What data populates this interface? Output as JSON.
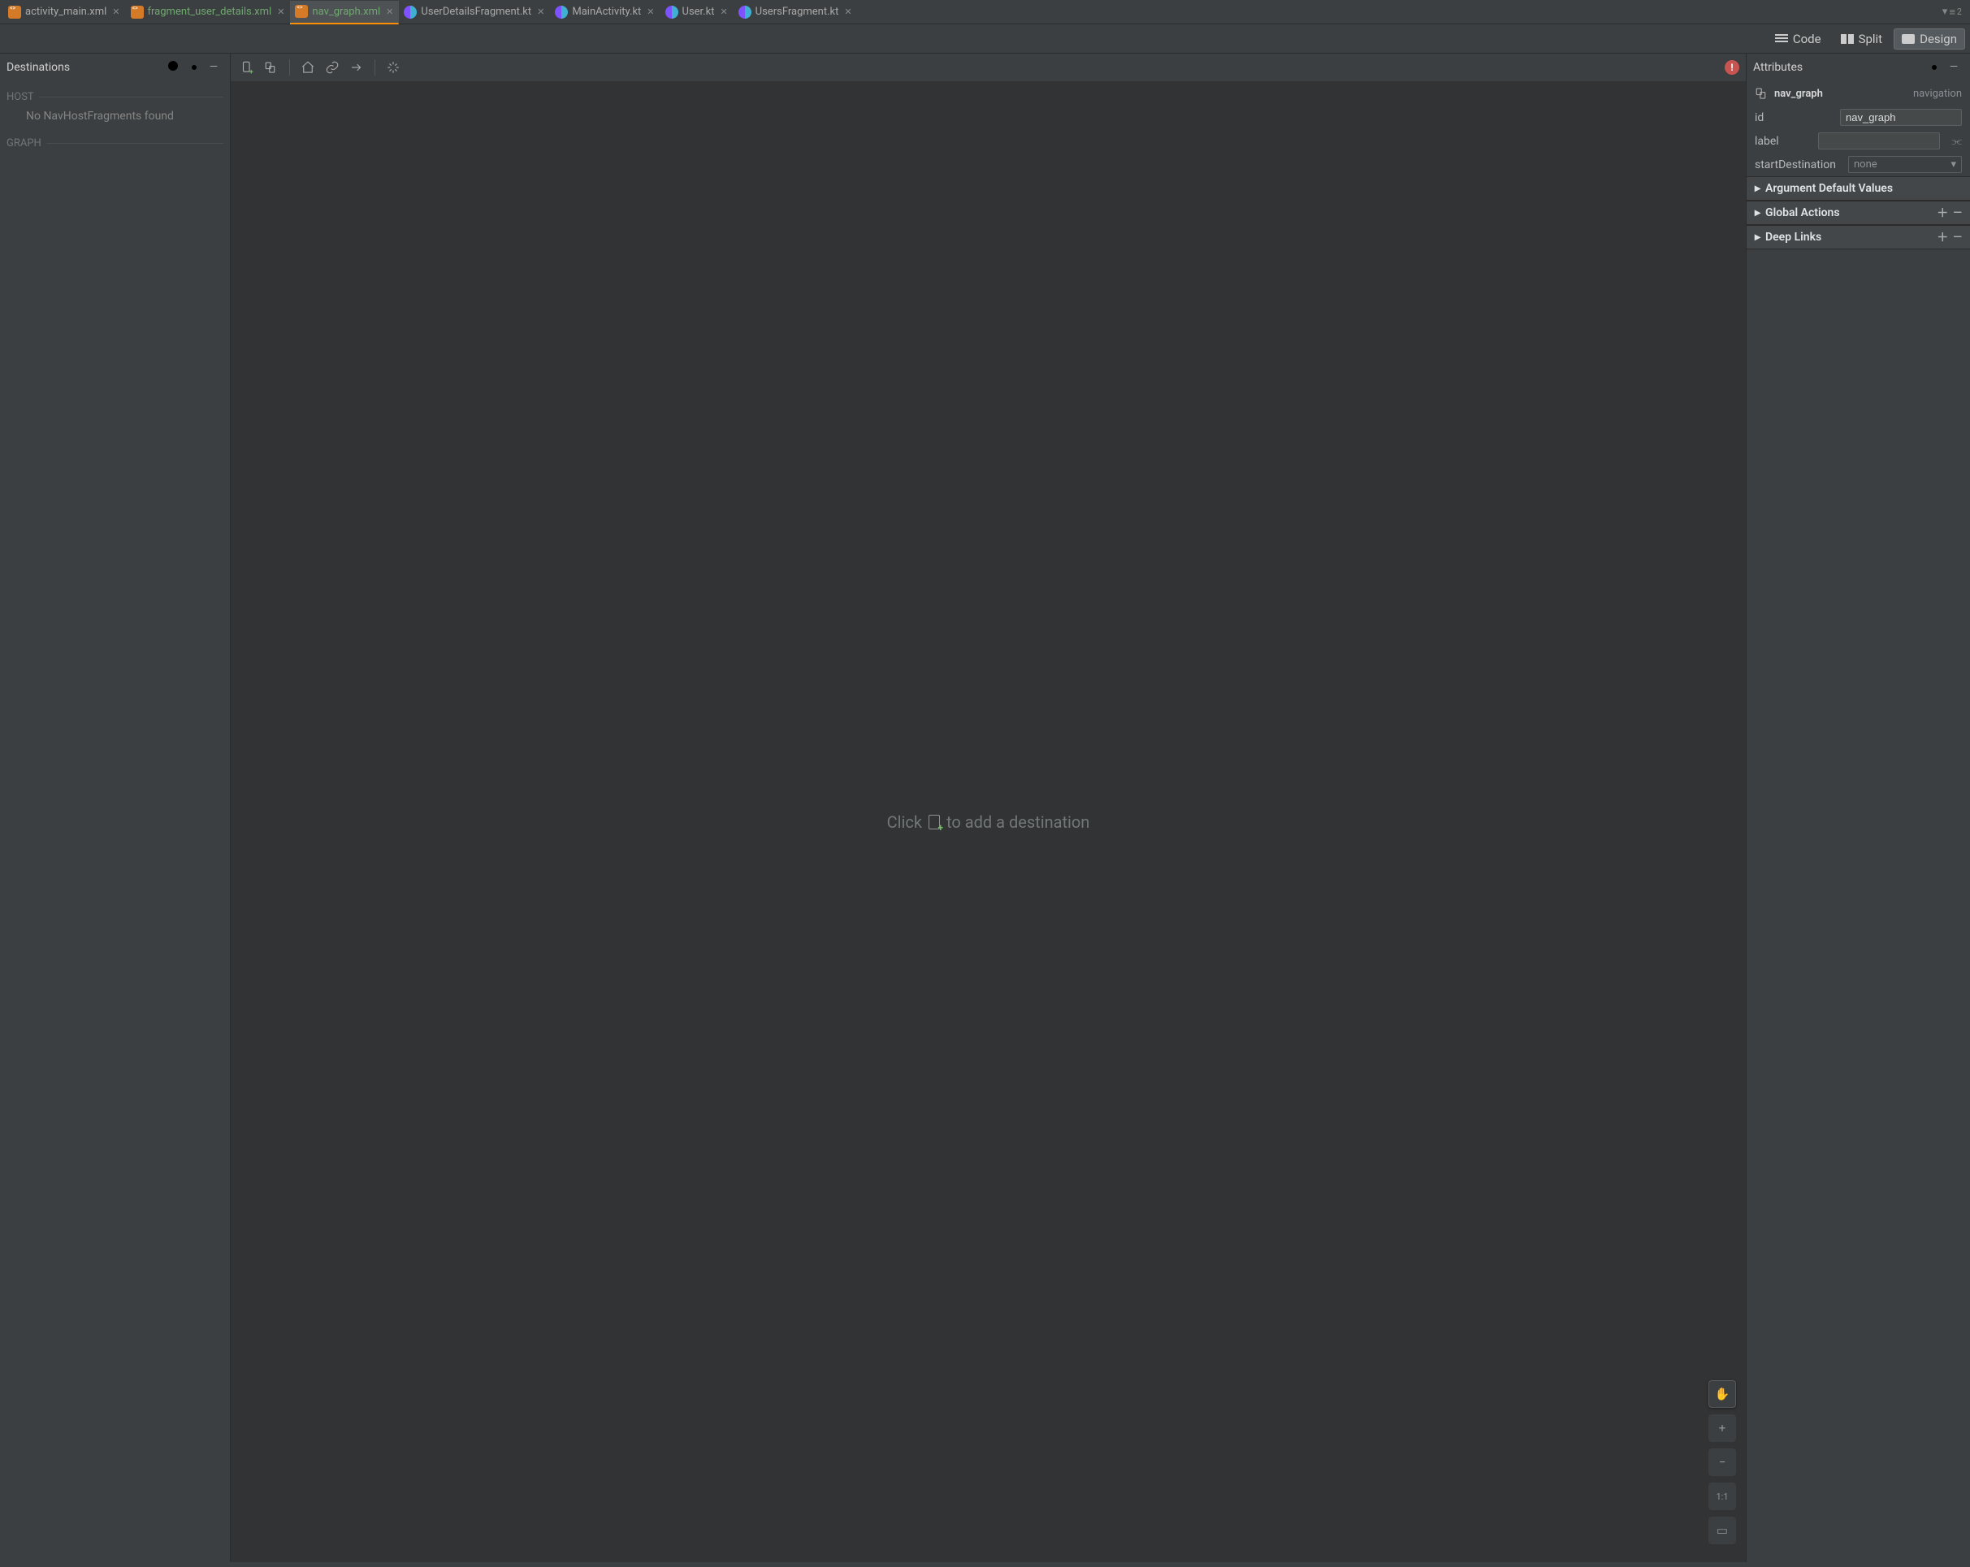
{
  "tabs": [
    {
      "label": "activity_main.xml",
      "icon": "xml",
      "active": false
    },
    {
      "label": "fragment_user_details.xml",
      "icon": "xml",
      "active": false
    },
    {
      "label": "nav_graph.xml",
      "icon": "xml",
      "active": true
    },
    {
      "label": "UserDetailsFragment.kt",
      "icon": "kt",
      "active": false
    },
    {
      "label": "MainActivity.kt",
      "icon": "kt",
      "active": false
    },
    {
      "label": "User.kt",
      "icon": "kt",
      "active": false
    },
    {
      "label": "UsersFragment.kt",
      "icon": "kt",
      "active": false
    }
  ],
  "tabsOverflowBadge": "2",
  "viewModes": {
    "code": "Code",
    "split": "Split",
    "design": "Design",
    "selected": "Design"
  },
  "leftPanel": {
    "title": "Destinations",
    "sections": {
      "hostLabel": "HOST",
      "hostEmpty": "No NavHostFragments found",
      "graphLabel": "GRAPH"
    }
  },
  "canvasHint": {
    "pre": "Click",
    "post": "to add a destination"
  },
  "floatControls": {
    "pan": "✋",
    "zoomIn": "+",
    "zoomOut": "−",
    "oneToOne": "1:1",
    "fit": "▭"
  },
  "rightPanel": {
    "title": "Attributes",
    "node": {
      "name": "nav_graph",
      "type": "navigation"
    },
    "fields": {
      "idLabel": "id",
      "idValue": "nav_graph",
      "labelLabel": "label",
      "labelValue": "",
      "startLabel": "startDestination",
      "startValue": "none"
    },
    "groups": {
      "adv": "Argument Default Values",
      "ga": "Global Actions",
      "dl": "Deep Links"
    }
  }
}
